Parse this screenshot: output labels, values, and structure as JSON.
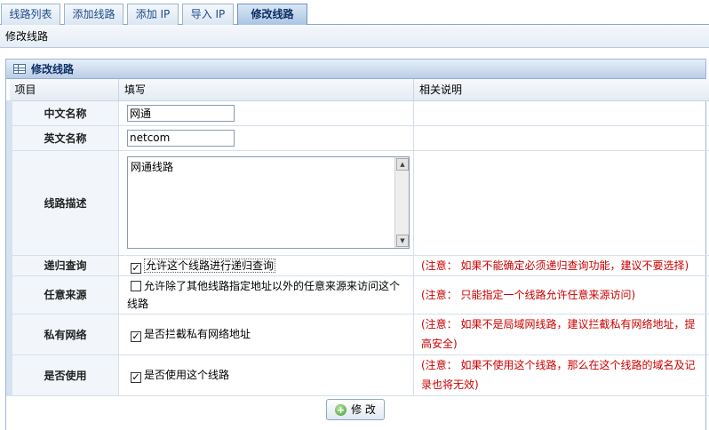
{
  "tabs": [
    {
      "label": "线路列表",
      "active": false
    },
    {
      "label": "添加线路",
      "active": false
    },
    {
      "label": "添加 IP",
      "active": false
    },
    {
      "label": "导入 IP",
      "active": false
    },
    {
      "label": "修改线路",
      "active": true
    }
  ],
  "breadcrumb": "修改线路",
  "panel": {
    "title": "修改线路",
    "icon": "table-icon"
  },
  "table": {
    "headers": [
      "项目",
      "填写",
      "相关说明"
    ],
    "rows": {
      "cn_name": {
        "label": "中文名称",
        "value": "网通"
      },
      "en_name": {
        "label": "英文名称",
        "value": "netcom"
      },
      "description": {
        "label": "线路描述",
        "value": "网通线路"
      },
      "recursion": {
        "label": "递归查询",
        "checkbox_label": "允许这个线路进行递归查询",
        "checked": true,
        "note": "(注意： 如果不能确定必须递归查询功能，建议不要选择)"
      },
      "any_source": {
        "label": "任意来源",
        "checkbox_label_line1": "允许除了其他线路指定地址以外的任意来源来访问这个",
        "checkbox_label_line2": "线路",
        "checked": false,
        "note": "(注意： 只能指定一个线路允许任意来源访问)"
      },
      "private_net": {
        "label": "私有网络",
        "checkbox_label": "是否拦截私有网络地址",
        "checked": true,
        "note_line1": "(注意： 如果不是局域网线路，建议拦截私有网络地址，提",
        "note_line2": "高安全)"
      },
      "enabled": {
        "label": "是否使用",
        "checkbox_label": "是否使用这个线路",
        "checked": true,
        "note_line1": "(注意： 如果不使用这个线路，那么在这个线路的域名及记",
        "note_line2": "录也将无效)"
      }
    }
  },
  "submit_label": "修 改",
  "colors": {
    "note_red": "#cc0000",
    "tab_text": "#1d4a8a",
    "panel_title": "#0d2f66",
    "header_blue": "#b9cde6"
  }
}
